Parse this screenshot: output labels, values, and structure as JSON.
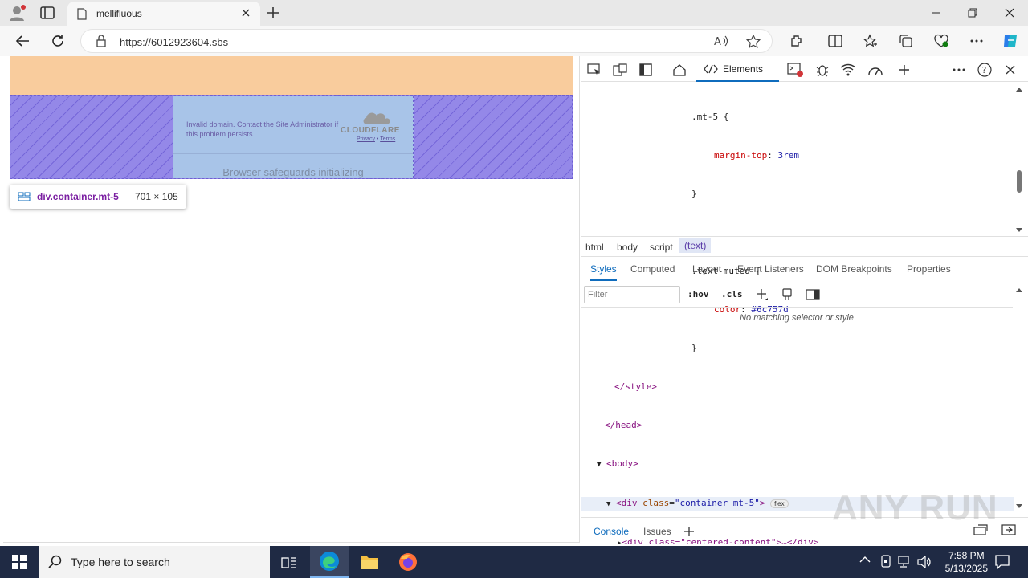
{
  "browser": {
    "tab_title": "mellifluous",
    "url": "https://6012923604.sbs"
  },
  "page": {
    "error_text": "Invalid domain. Contact the Site Administrator if this problem persists.",
    "cf_wordmark": "CLOUDFLARE",
    "privacy_link": "Privacy",
    "links_sep": "•",
    "terms_link": "Terms",
    "safeguard_text": "Browser safeguards initializing"
  },
  "inspect_tooltip": {
    "element": "div.container.mt-5",
    "size": "701 × 105"
  },
  "devtools": {
    "elements_tab": "Elements",
    "code_lines": {
      "l1_sel": ".mt-5 {",
      "l2_prop": "margin-top",
      "l2_val": "3rem",
      "l3": "}",
      "l4_sel": ".text-muted {",
      "l5_prop": "color",
      "l5_val": "#6c757d",
      "l6": "}",
      "l7": "</style>",
      "l8": "</head>",
      "l9": "<body>",
      "l10_tag": "<div",
      "l10_attr": "class",
      "l10_val": "\"container mt-5\"",
      "l10_end": ">",
      "l10_badge": "flex",
      "l11": "<div class=\"centered-content\">…</div>"
    },
    "breadcrumbs": [
      "html",
      "body",
      "script",
      "(text)"
    ],
    "subtabs": [
      "Styles",
      "Computed",
      "Layout",
      "Event Listeners",
      "DOM Breakpoints",
      "Properties"
    ],
    "filter_placeholder": "Filter",
    "hov": ":hov",
    "cls": ".cls",
    "no_match": "No matching selector or style",
    "drawer_tabs": [
      "Console",
      "Issues"
    ]
  },
  "watermark": "ANY RUN",
  "taskbar": {
    "search_placeholder": "Type here to search",
    "time": "7:58 PM",
    "date": "5/13/2025"
  },
  "colors": {
    "accent": "#0f6cbd",
    "margin_highlight": "#f9cc9d",
    "content_highlight": "#9488e8",
    "taskbar": "#1f2a44"
  }
}
